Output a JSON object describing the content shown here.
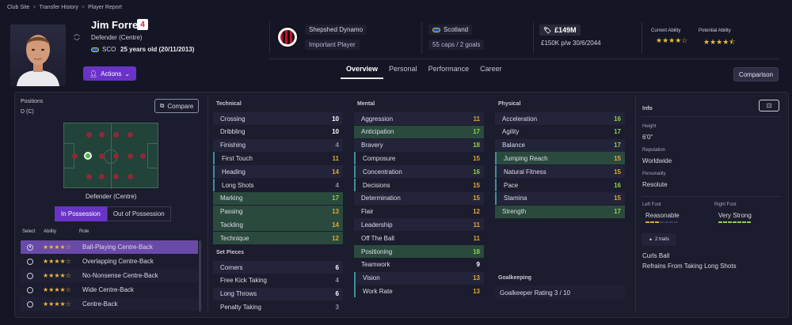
{
  "breadcrumb": [
    "Club Site",
    "Transfer History",
    "Player Report"
  ],
  "player": {
    "name": "Jim Forrest",
    "number": "4",
    "position": "Defender (Centre)",
    "nationality_code": "SCO",
    "age_dob": "25 years old (20/11/2013)"
  },
  "actions_label": "Actions",
  "club": {
    "name": "Shepshed Dynamo",
    "status": "Important Player"
  },
  "country": {
    "name": "Scotland",
    "caps": "55 caps / 2 goals"
  },
  "contract": {
    "value": "£149M",
    "wage": "£150K p/w 30/6/2044"
  },
  "ability": {
    "current_label": "Current Ability",
    "potential_label": "Potential Ability",
    "current_stars": "★★★★☆",
    "potential_stars": "★★★★⯪"
  },
  "tabs": [
    "Overview",
    "Personal",
    "Performance",
    "Career"
  ],
  "comparison_label": "Comparison",
  "positions": {
    "label": "Positions",
    "value": "D (C)",
    "compare_label": "Compare",
    "pitch_caption": "Defender (Centre)",
    "in_possession": "In Possession",
    "out_possession": "Out of Possession"
  },
  "roles": {
    "headers": [
      "Select",
      "Ability",
      "Role"
    ],
    "items": [
      {
        "stars": "★★★★☆",
        "role": "Ball-Playing Centre-Back",
        "selected": true
      },
      {
        "stars": "★★★★☆",
        "role": "Overlapping Centre-Back",
        "selected": false
      },
      {
        "stars": "★★★★☆",
        "role": "No-Nonsense Centre-Back",
        "selected": false
      },
      {
        "stars": "★★★★☆",
        "role": "Wide Centre-Back",
        "selected": false
      },
      {
        "stars": "★★★★☆",
        "role": "Centre-Back",
        "selected": false
      }
    ]
  },
  "technical": {
    "title": "Technical",
    "attrs": [
      {
        "name": "Crossing",
        "value": "10",
        "color": "white"
      },
      {
        "name": "Dribbling",
        "value": "10",
        "color": "white"
      },
      {
        "name": "Finishing",
        "value": "4",
        "color": "grey"
      },
      {
        "name": "First Touch",
        "value": "11",
        "color": "yellow"
      },
      {
        "name": "Heading",
        "value": "14",
        "color": "yellow"
      },
      {
        "name": "Long Shots",
        "value": "4",
        "color": "grey"
      },
      {
        "name": "Marking",
        "value": "17",
        "color": "green"
      },
      {
        "name": "Passing",
        "value": "13",
        "color": "yellow"
      },
      {
        "name": "Tackling",
        "value": "14",
        "color": "yellow"
      },
      {
        "name": "Technique",
        "value": "12",
        "color": "yellow"
      }
    ]
  },
  "set_pieces": {
    "title": "Set Pieces",
    "attrs": [
      {
        "name": "Corners",
        "value": "6",
        "color": "white"
      },
      {
        "name": "Free Kick Taking",
        "value": "4",
        "color": "grey"
      },
      {
        "name": "Long Throws",
        "value": "6",
        "color": "white"
      },
      {
        "name": "Penalty Taking",
        "value": "3",
        "color": "grey"
      }
    ]
  },
  "mental": {
    "title": "Mental",
    "attrs": [
      {
        "name": "Aggression",
        "value": "11",
        "color": "yellow"
      },
      {
        "name": "Anticipation",
        "value": "17",
        "color": "green"
      },
      {
        "name": "Bravery",
        "value": "18",
        "color": "green"
      },
      {
        "name": "Composure",
        "value": "15",
        "color": "yellow"
      },
      {
        "name": "Concentration",
        "value": "16",
        "color": "green"
      },
      {
        "name": "Decisions",
        "value": "15",
        "color": "yellow"
      },
      {
        "name": "Determination",
        "value": "15",
        "color": "yellow"
      },
      {
        "name": "Flair",
        "value": "12",
        "color": "yellow"
      },
      {
        "name": "Leadership",
        "value": "11",
        "color": "yellow"
      },
      {
        "name": "Off The Ball",
        "value": "11",
        "color": "yellow"
      },
      {
        "name": "Positioning",
        "value": "18",
        "color": "green"
      },
      {
        "name": "Teamwork",
        "value": "9",
        "color": "white"
      },
      {
        "name": "Vision",
        "value": "13",
        "color": "yellow"
      },
      {
        "name": "Work Rate",
        "value": "13",
        "color": "yellow"
      }
    ]
  },
  "physical": {
    "title": "Physical",
    "attrs": [
      {
        "name": "Acceleration",
        "value": "16",
        "color": "green"
      },
      {
        "name": "Agility",
        "value": "17",
        "color": "green"
      },
      {
        "name": "Balance",
        "value": "17",
        "color": "green"
      },
      {
        "name": "Jumping Reach",
        "value": "15",
        "color": "yellow"
      },
      {
        "name": "Natural Fitness",
        "value": "15",
        "color": "yellow"
      },
      {
        "name": "Pace",
        "value": "16",
        "color": "green"
      },
      {
        "name": "Stamina",
        "value": "15",
        "color": "yellow"
      },
      {
        "name": "Strength",
        "value": "17",
        "color": "green"
      }
    ]
  },
  "goalkeeping": {
    "title": "Goalkeeping",
    "rating": "Goalkeeper Rating 3 / 10"
  },
  "info": {
    "title": "Info",
    "height_label": "Height",
    "height": "6'0\"",
    "reputation_label": "Reputation",
    "reputation": "Worldwide",
    "personality_label": "Personality",
    "personality": "Resolute",
    "left_foot_label": "Left Foot",
    "left_foot": "Reasonable",
    "right_foot_label": "Right Foot",
    "right_foot": "Very Strong",
    "traits_label": "2 traits",
    "traits": [
      "Curls Ball",
      "Refrains From Taking Long Shots"
    ]
  },
  "colors": {
    "white": "#ffffff",
    "grey": "#8d8fa3",
    "yellow": "#e0a92e",
    "green": "#8bd04a",
    "accent": "#6a33c7"
  }
}
